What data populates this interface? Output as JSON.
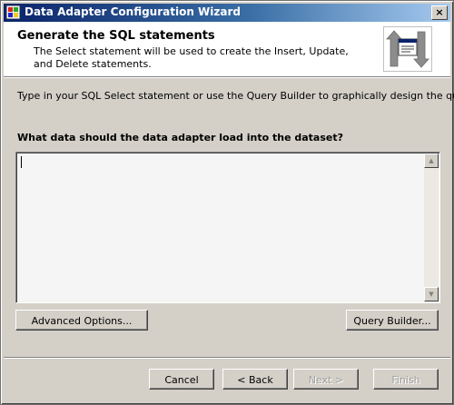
{
  "window": {
    "title": "Data Adapter Configuration Wizard",
    "close_label": "×"
  },
  "header": {
    "title": "Generate the SQL statements",
    "description": "The Select statement will be used to create the Insert, Update, and Delete statements."
  },
  "body": {
    "instruction": "Type in your SQL Select statement or use the Query Builder to graphically design the query.",
    "question": "What data should the data adapter load into the dataset?",
    "sql_text": ""
  },
  "buttons": {
    "advanced_options": "Advanced Options...",
    "query_builder": "Query Builder...",
    "cancel": "Cancel",
    "back": "< Back",
    "next": "Next >",
    "finish": "Finish"
  },
  "icons": {
    "app": "app-icon",
    "header_graphic": "data-transfer-icon"
  },
  "colors": {
    "title_bar_start": "#0a246a",
    "title_bar_end": "#a6caf0",
    "window_face": "#d4d0c8",
    "header_background": "#ffffff",
    "disabled_text": "#a0a0a0"
  },
  "state": {
    "next_enabled": false,
    "finish_enabled": false
  }
}
